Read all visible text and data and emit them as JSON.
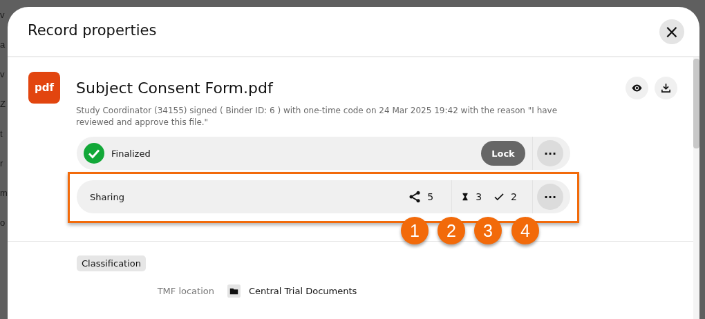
{
  "background": {
    "fragments": [
      "v",
      "a",
      "v",
      "Z",
      "t",
      "r",
      "m",
      "o"
    ]
  },
  "dialog": {
    "title": "Record properties",
    "close": "×"
  },
  "record": {
    "file_type": "pdf",
    "name": "Subject Consent Form.pdf",
    "signature": "Study Coordinator (34155) signed ( Binder ID: 6 ) with one-time code on 24 Mar 2025 19:42 with the reason \"I have reviewed and approve this file.\"",
    "actions": [
      {
        "kind": "preview"
      },
      {
        "kind": "download"
      }
    ]
  },
  "status_row": {
    "label": "Finalized",
    "finalized": true,
    "button": "Lock",
    "more": "···"
  },
  "sharing_row": {
    "label": "Sharing",
    "highlighted": true,
    "counts": [
      {
        "kind": "shared",
        "count": "5"
      },
      {
        "kind": "pending",
        "count": "3"
      },
      {
        "kind": "done",
        "count": "2"
      }
    ],
    "more": "···"
  },
  "callouts": [
    "1",
    "2",
    "3",
    "4"
  ],
  "classification": {
    "heading": "Classification",
    "fields": [
      {
        "label": "TMF location",
        "value": "Central Trial Documents"
      }
    ]
  }
}
